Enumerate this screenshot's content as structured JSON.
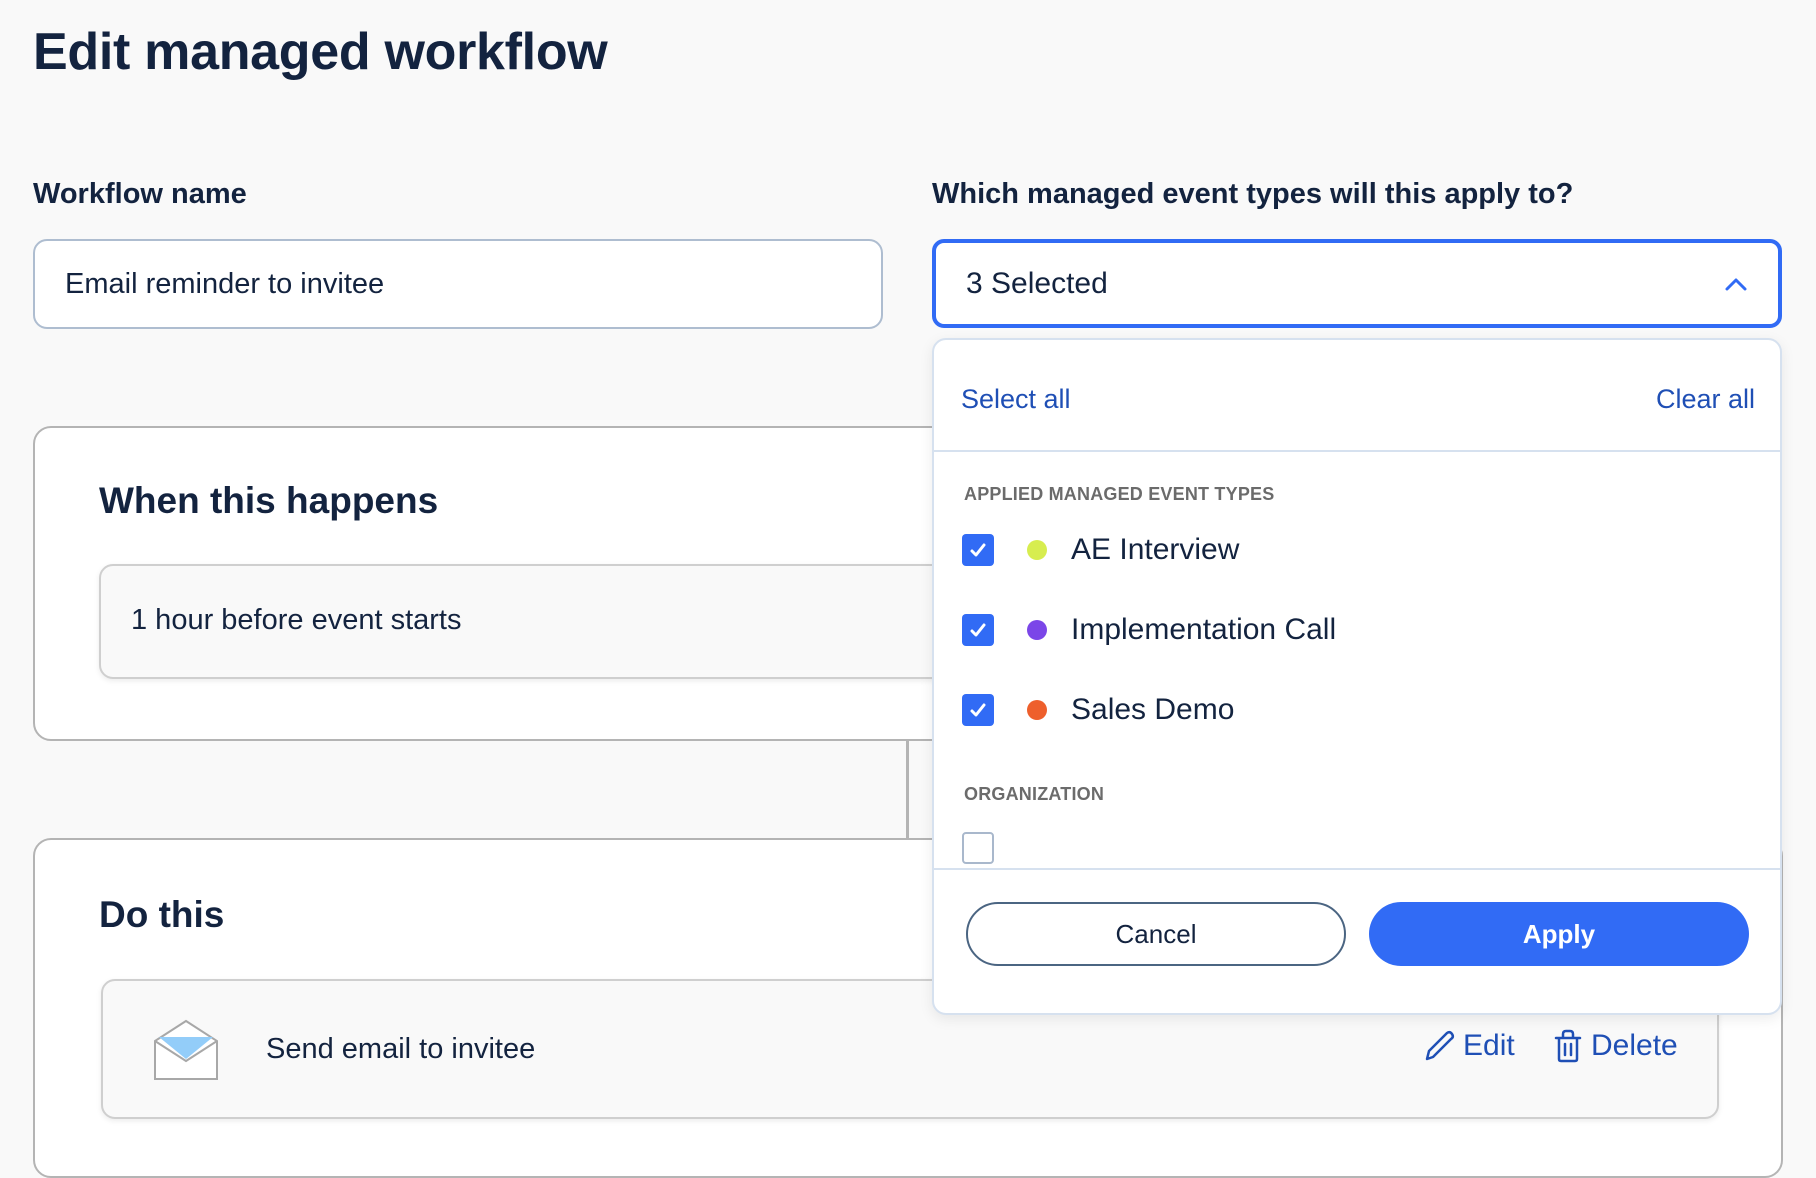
{
  "page": {
    "title": "Edit managed workflow"
  },
  "workflow_name": {
    "label": "Workflow name",
    "value": "Email reminder to invitee"
  },
  "event_types": {
    "label": "Which managed event types will this apply to?",
    "selected_summary": "3 Selected",
    "expanded": true,
    "panel": {
      "select_all": "Select all",
      "clear_all": "Clear all",
      "sections": [
        {
          "heading": "APPLIED MANAGED EVENT TYPES",
          "items": [
            {
              "label": "AE Interview",
              "checked": true,
              "color": "#d7ed4f"
            },
            {
              "label": "Implementation Call",
              "checked": true,
              "color": "#7b46e8"
            },
            {
              "label": "Sales Demo",
              "checked": true,
              "color": "#ee5f2c"
            }
          ]
        },
        {
          "heading": "ORGANIZATION",
          "items": [
            {
              "label": "",
              "checked": false
            }
          ]
        }
      ],
      "cancel": "Cancel",
      "apply": "Apply"
    }
  },
  "trigger": {
    "heading": "When this happens",
    "value": "1 hour before event starts"
  },
  "action": {
    "heading": "Do this",
    "label": "Send email to invitee",
    "icon": "envelope-open-icon",
    "edit": "Edit",
    "delete": "Delete"
  },
  "colors": {
    "accent": "#316bf5",
    "link": "#1f4fb5",
    "text": "#13233f"
  }
}
